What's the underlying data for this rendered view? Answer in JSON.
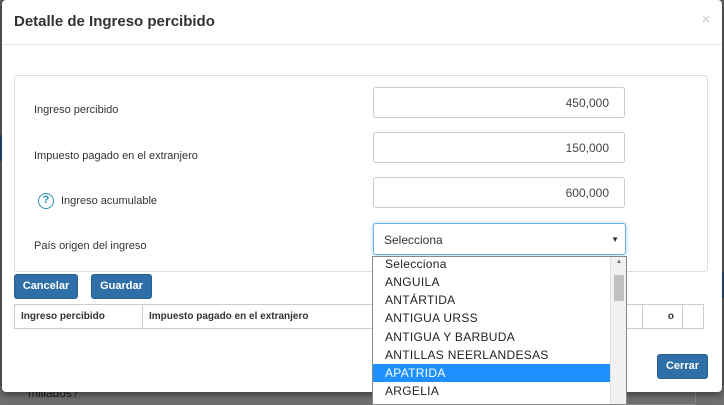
{
  "modal": {
    "title": "Detalle de Ingreso percibido",
    "close_icon": "×"
  },
  "form": {
    "ingreso_percibido": {
      "label": "Ingreso percibido",
      "value": "450,000"
    },
    "impuesto_extranjero": {
      "label": "Impuesto pagado en el extranjero",
      "value": "150,000"
    },
    "ingreso_acumulable": {
      "label": "Ingreso acumulable",
      "value": "600,000",
      "help_icon": "question-circle-icon"
    },
    "pais_origen": {
      "label": "País origen del ingreso",
      "selected": "Selecciona"
    }
  },
  "buttons": {
    "cancelar": "Cancelar",
    "guardar": "Guardar",
    "cerrar": "Cerrar"
  },
  "table": {
    "headers": [
      "Ingreso percibido",
      "Impuesto pagado en el extranjero",
      "o"
    ]
  },
  "dropdown": {
    "options": [
      "Selecciona",
      "ANGUILA",
      "ANTÁRTIDA",
      "ANTIGUA URSS",
      "ANTIGUA Y BARBUDA",
      "ANTILLAS NEERLANDESAS",
      "APATRIDA",
      "ARGELIA"
    ],
    "highlighted": "APATRIDA"
  },
  "backdrop": {
    "text": "miliados?"
  },
  "colors": {
    "primary_button": "#2f6fa7",
    "highlight": "#1e90ff",
    "help_icon": "#2a8fb5"
  }
}
